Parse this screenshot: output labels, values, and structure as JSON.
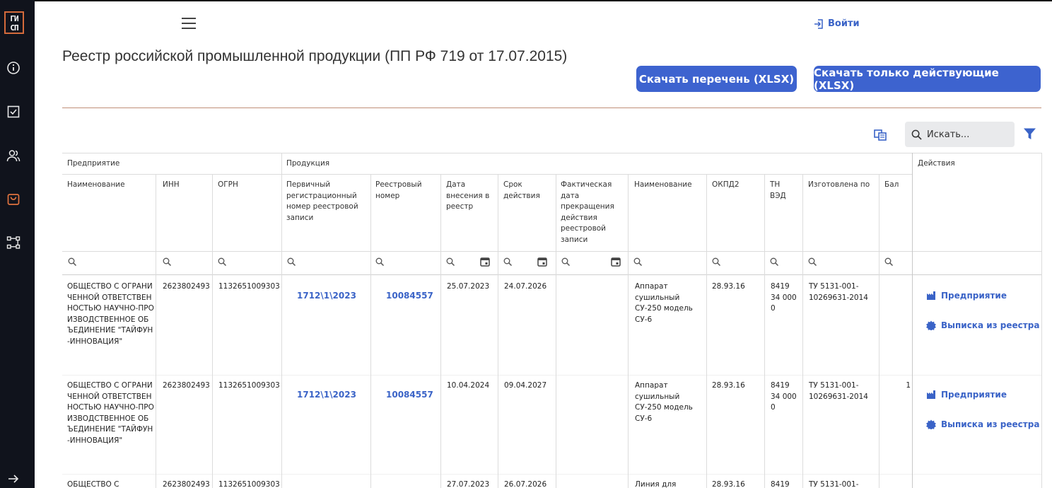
{
  "app": {
    "logo_line1": "ГИ",
    "logo_line2": "СП"
  },
  "sidebar": {
    "items": [
      {
        "icon": "info-icon"
      },
      {
        "icon": "checkbox-icon"
      },
      {
        "icon": "users-icon"
      },
      {
        "icon": "shopping-bag-icon",
        "active": true
      },
      {
        "icon": "workflow-icon"
      }
    ],
    "expand_icon": "arrow-right-icon"
  },
  "header": {
    "login_label": "Войти"
  },
  "page": {
    "title": "Реестр российской промышленной продукции (ПП РФ 719 от 17.07.2015)",
    "download_all_label": "Скачать перечень (XLSX)",
    "download_active_label": "Скачать только действующие (XLSX)"
  },
  "toolbar": {
    "search_placeholder": "Искать..."
  },
  "colors": {
    "accent": "#3d63cf",
    "link": "#3a63c7",
    "sidebar_bg": "#10131c",
    "logo_border": "#d46a3b"
  },
  "table": {
    "groups": {
      "enterprise": "Предприятие",
      "product": "Продукция",
      "actions": "Действия"
    },
    "columns": {
      "name": "Наименование",
      "inn": "ИНН",
      "ogrn": "ОГРН",
      "primary_reg": "Первичный регистрационный номер реестровой записи",
      "reg_number": "Реестровый номер",
      "date_added": "Дата внесения в реестр",
      "valid_until": "Срок действия",
      "date_terminated": "Фактическая дата прекращения действия реестровой записи",
      "product_name": "Наименование",
      "okpd2": "ОКПД2",
      "tn_ved": "ТН ВЭД",
      "made_by": "Изготовлена по",
      "balls": "Бал"
    },
    "rows": [
      {
        "name": "ОБЩЕСТВО С ОГРАНИЧЕННОЙ ОТВЕТСТВЕННОСТЬЮ НАУЧНО-ПРОИЗВОДСТВЕННОЕ ОБЪЕДИНЕНИЕ \"ТАЙФУН-ИННОВАЦИЯ\"",
        "inn": "2623802493",
        "ogrn": "1132651009303",
        "primary_reg": "1712\\1\\2023",
        "reg_number": "10084557",
        "date_added": "25.07.2023",
        "valid_until": "24.07.2026",
        "date_terminated": "",
        "product_name": "Аппарат сушильный СУ-250 модель СУ-6",
        "okpd2": "28.93.16",
        "tn_ved": "8419 34 000 0",
        "made_by": "ТУ 5131-001-10269631-2014",
        "balls": "",
        "action_enterprise": "Предприятие",
        "action_extract": "Выписка из реестра"
      },
      {
        "name": "ОБЩЕСТВО С ОГРАНИЧЕННОЙ ОТВЕТСТВЕННОСТЬЮ НАУЧНО-ПРОИЗВОДСТВЕННОЕ ОБЪЕДИНЕНИЕ \"ТАЙФУН-ИННОВАЦИЯ\"",
        "inn": "2623802493",
        "ogrn": "1132651009303",
        "primary_reg": "1712\\1\\2023",
        "reg_number": "10084557",
        "date_added": "10.04.2024",
        "valid_until": "09.04.2027",
        "date_terminated": "",
        "product_name": "Аппарат сушильный СУ-250 модель СУ-6",
        "okpd2": "28.93.16",
        "tn_ved": "8419 34 000 0",
        "made_by": "ТУ 5131-001-10269631-2014",
        "balls": "1",
        "action_enterprise": "Предприятие",
        "action_extract": "Выписка из реестра"
      },
      {
        "name": "ОБЩЕСТВО С",
        "inn": "2623802493",
        "ogrn": "1132651009303",
        "primary_reg": "",
        "reg_number": "",
        "date_added": "27.07.2023",
        "valid_until": "26.07.2026",
        "date_terminated": "",
        "product_name": "Линия для",
        "okpd2": "28.93.16",
        "tn_ved": "8419",
        "made_by": "ТУ 5131-001-",
        "balls": "",
        "action_enterprise": "",
        "action_extract": ""
      }
    ]
  }
}
